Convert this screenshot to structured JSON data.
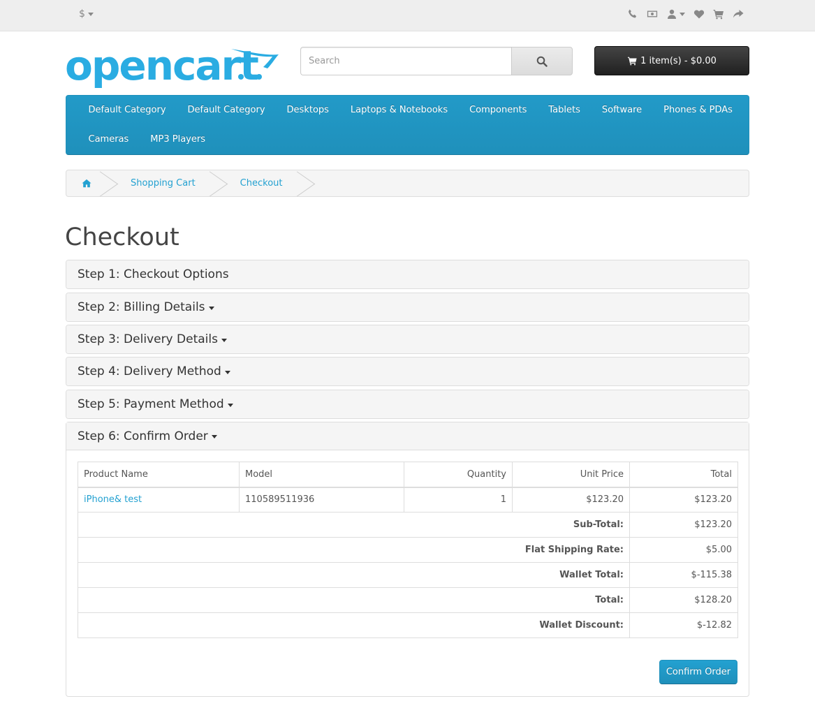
{
  "topbar": {
    "currency_symbol": "$",
    "icons": [
      "phone-icon",
      "money-icon",
      "user-icon",
      "heart-icon",
      "cart-icon",
      "share-icon"
    ]
  },
  "header": {
    "logo_text": "opencart",
    "search_placeholder": "Search",
    "search_value": "",
    "cart_label": "1 item(s) - $0.00"
  },
  "menu": {
    "row1": [
      "Default Category",
      "Default Category",
      "Desktops",
      "Laptops & Notebooks",
      "Components",
      "Tablets",
      "Software",
      "Phones & PDAs"
    ],
    "row2": [
      "Cameras",
      "MP3 Players"
    ]
  },
  "breadcrumb": {
    "items": [
      "Shopping Cart",
      "Checkout"
    ]
  },
  "page": {
    "title": "Checkout"
  },
  "steps": [
    {
      "label": "Step 1: Checkout Options",
      "caret": false
    },
    {
      "label": "Step 2: Billing Details",
      "caret": true
    },
    {
      "label": "Step 3: Delivery Details",
      "caret": true
    },
    {
      "label": "Step 4: Delivery Method",
      "caret": true
    },
    {
      "label": "Step 5: Payment Method",
      "caret": true
    },
    {
      "label": "Step 6: Confirm Order",
      "caret": true
    }
  ],
  "order": {
    "headers": {
      "product": "Product Name",
      "model": "Model",
      "quantity": "Quantity",
      "unit_price": "Unit Price",
      "total": "Total"
    },
    "items": [
      {
        "product": "iPhone& test",
        "model": "110589511936",
        "quantity": "1",
        "unit_price": "$123.20",
        "total": "$123.20"
      }
    ],
    "totals": [
      {
        "label": "Sub-Total:",
        "value": "$123.20"
      },
      {
        "label": "Flat Shipping Rate:",
        "value": "$5.00"
      },
      {
        "label": "Wallet Total:",
        "value": "$-115.38"
      },
      {
        "label": "Total:",
        "value": "$128.20"
      },
      {
        "label": "Wallet Discount:",
        "value": "$-12.82"
      }
    ],
    "confirm_label": "Confirm Order"
  },
  "colors": {
    "accent": "#229ac8",
    "link": "#23a1d1",
    "cart_button": "#303030"
  }
}
